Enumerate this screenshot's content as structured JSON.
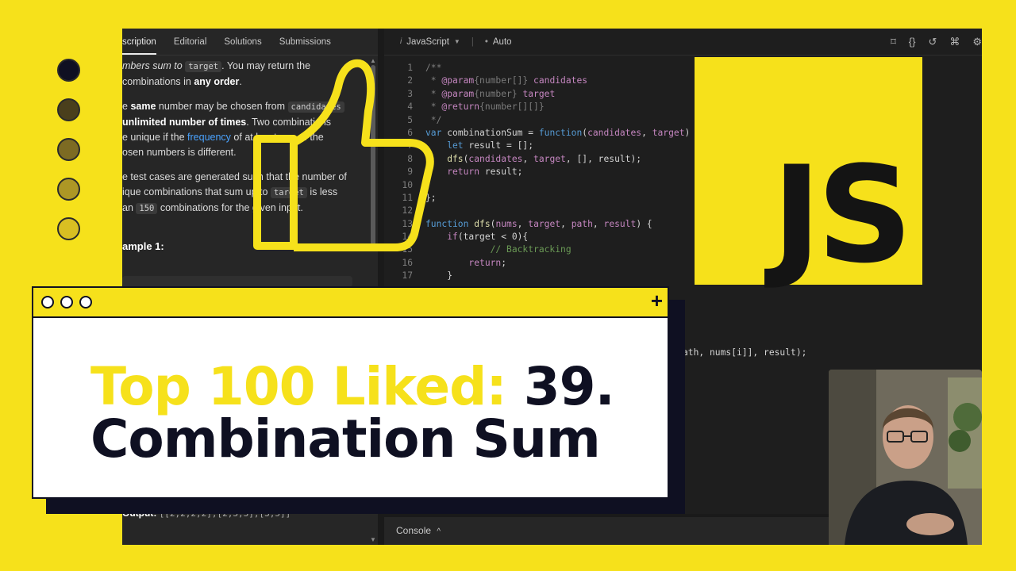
{
  "description_panel": {
    "tabs": [
      {
        "label": "scription"
      },
      {
        "label": "Editorial"
      },
      {
        "label": "Solutions"
      },
      {
        "label": "Submissions"
      }
    ],
    "paragraphs": {
      "p1_a": "mbers sum to",
      "p1_code": "target",
      "p1_b": ". You may return the",
      "p1_c": "combinations in",
      "p1_bold": "any order",
      "p2_a": "e",
      "p2_bold1": "same",
      "p2_b": "number may be chosen from",
      "p2_code": "candidates",
      "p2_bold2": "unlimited number of times",
      "p2_c": ". Two combinations",
      "p2_d": "e unique if the",
      "p2_link": "frequency",
      "p2_e": "of at least one of the",
      "p2_f": "osen numbers is different.",
      "p3_a": "e test cases are generated such that the number of",
      "p3_b": "ique combinations that sum up to",
      "p3_code": "target",
      "p3_c": "is less",
      "p3_d": "an",
      "p3_code2": "150",
      "p3_e": "combinations for the given input."
    },
    "example_title": "ample 1:",
    "output_label": "Output:",
    "output_value": "[[2,2,2,2],[2,3,3],[3,5]]"
  },
  "editor": {
    "language": "JavaScript",
    "mode": "Auto",
    "code_lines": [
      {
        "n": "1",
        "text": "/**"
      },
      {
        "n": "2",
        "text": " * @param {number[]} candidates"
      },
      {
        "n": "3",
        "text": " * @param {number} target"
      },
      {
        "n": "4",
        "text": " * @return {number[][]}"
      },
      {
        "n": "5",
        "text": " */"
      },
      {
        "n": "6",
        "text": "var combinationSum = function(candidates, target) {"
      },
      {
        "n": "7",
        "text": "    let result = [];"
      },
      {
        "n": "8",
        "text": "    dfs(candidates, target, [], result);"
      },
      {
        "n": "9",
        "text": "    return result;"
      },
      {
        "n": "10",
        "text": ""
      },
      {
        "n": "11",
        "text": "};"
      },
      {
        "n": "12",
        "text": ""
      },
      {
        "n": "13",
        "text": "function dfs(nums, target, path, result) {"
      },
      {
        "n": "14",
        "text": "    if(target < 0){"
      },
      {
        "n": "15",
        "text": "            // Backtracking"
      },
      {
        "n": "16",
        "text": "        return;"
      },
      {
        "n": "17",
        "text": "    }"
      }
    ],
    "partial_line": "ath, nums[i]], result);",
    "console_label": "Console"
  },
  "js_logo": {
    "text": "JS"
  },
  "title_card": {
    "title_yellow": "Top 100 Liked:",
    "title_dark": "39.",
    "subtitle": "Combination Sum"
  },
  "colors": {
    "background": "#f6e11b",
    "navy": "#0f1022",
    "editor_bg": "#1e1e1e"
  }
}
